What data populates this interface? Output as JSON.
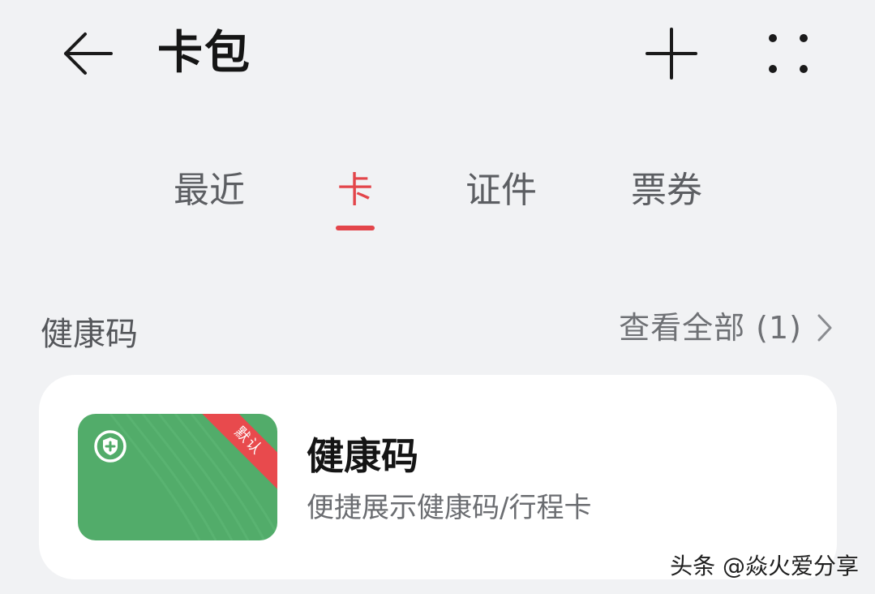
{
  "header": {
    "title": "卡包",
    "back_icon": "arrow-left-icon",
    "add_icon": "plus-icon",
    "more_icon": "four-dots-icon"
  },
  "tabs": [
    {
      "label": "最近",
      "active": false
    },
    {
      "label": "卡",
      "active": true
    },
    {
      "label": "证件",
      "active": false
    },
    {
      "label": "票券",
      "active": false
    }
  ],
  "section": {
    "title": "健康码",
    "view_all_label": "查看全部 (1)"
  },
  "card": {
    "name": "健康码",
    "description": "便捷展示健康码/行程卡",
    "badge": "默认",
    "thumb_color": "#52ac6a",
    "badge_color": "#e84a4d"
  },
  "watermark": "头条 @焱火爱分享",
  "colors": {
    "accent": "#e3454a",
    "background": "#f1f2f4"
  }
}
